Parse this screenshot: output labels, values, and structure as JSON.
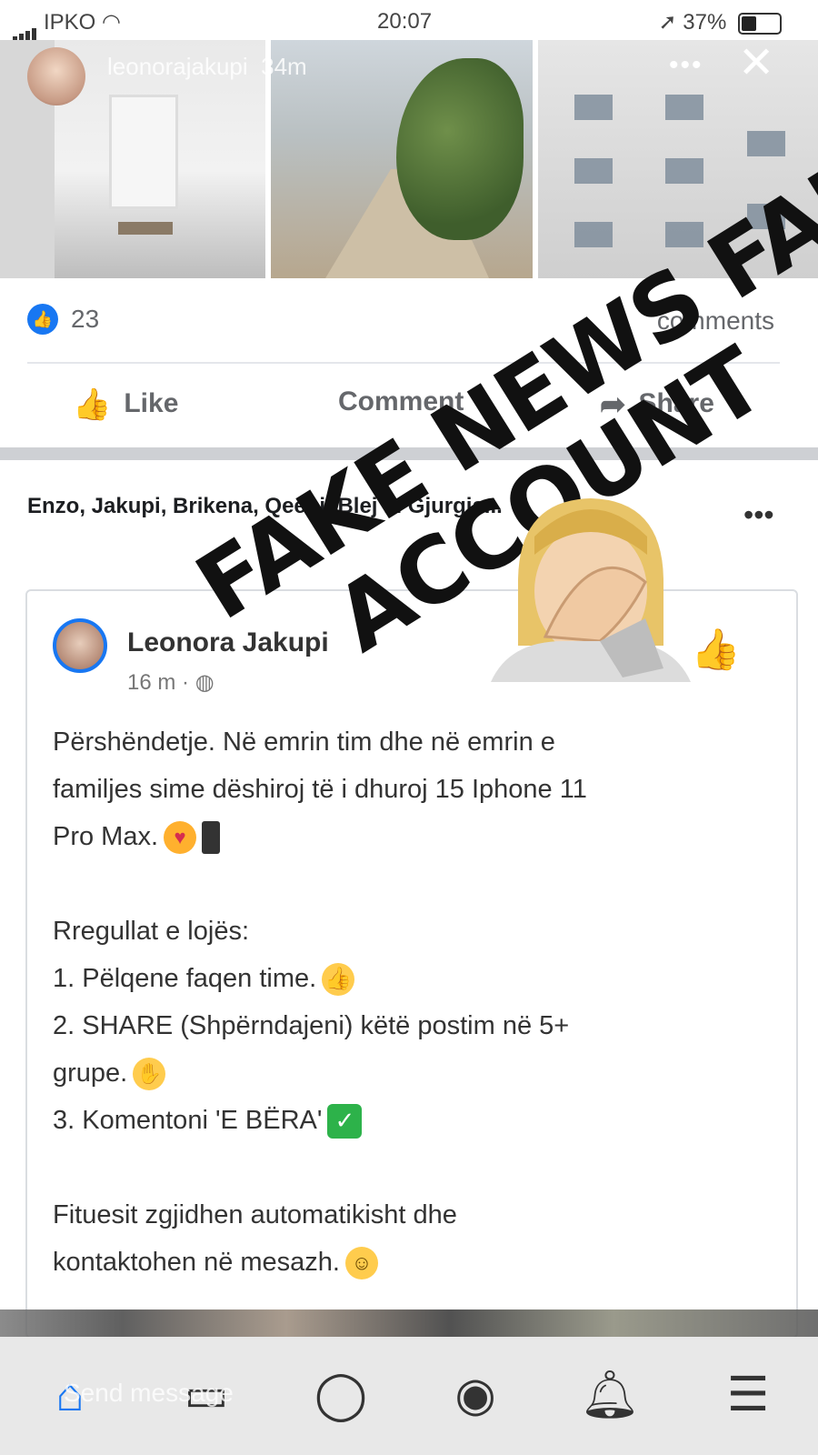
{
  "status_bar": {
    "carrier": "IPKO",
    "time": "20:07",
    "battery": "37%"
  },
  "story": {
    "username": "leonorajakupi",
    "age": "34m",
    "dots": "•••",
    "close": "✕"
  },
  "reactions": {
    "count": "23",
    "comments": "comments"
  },
  "actions": {
    "like": "Like",
    "comment": "Comment",
    "share": "Share"
  },
  "shared_line": "Enzo, Jakupi, Brikena, Qeeni, Blej ... Gjurgja...",
  "more": "•••",
  "post": {
    "author": "Leonora Jakupi",
    "time": "16 m · ",
    "line1": "Përshëndetje. Në emrin tim dhe në emrin e",
    "line2": "familjes sime dëshiroj të i dhuroj 15 Iphone 11",
    "line3": "Pro Max.",
    "rules_title": "Rregullat e lojës:",
    "rule1": "1. Pëlqene faqen time.",
    "rule2a": "2. SHARE (Shpërndajeni) këtë postim në 5+",
    "rule2b": "grupe.",
    "rule3": "3. Komentoni 'E BËRA'",
    "closing1": "Fituesit zgjidhen automatikisht dhe",
    "closing2": "kontaktohen në mesazh."
  },
  "overlay": {
    "line1": "FAKE NEWS FAKE",
    "line2": "ACCOUNT"
  },
  "bottom": {
    "send_message": "Send message"
  },
  "colors": {
    "facebook_blue": "#1877f2",
    "divider": "#e4e6eb",
    "muted_text": "#65676b",
    "check_green": "#2db24a"
  }
}
